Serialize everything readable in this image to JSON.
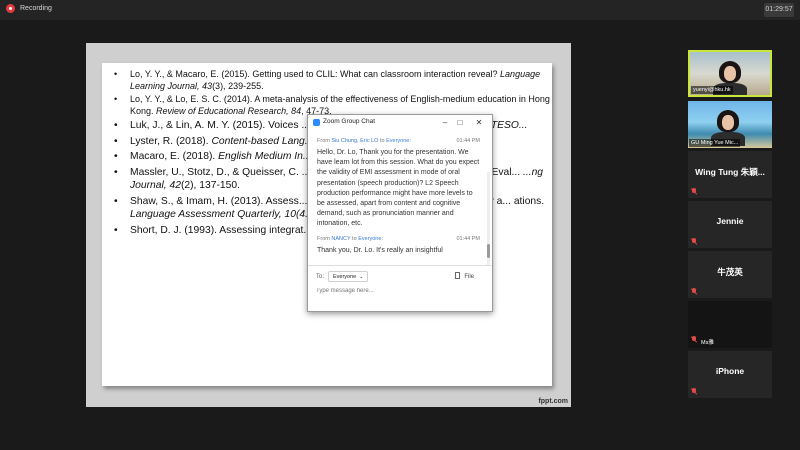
{
  "topbar": {
    "recording_label": "Recording",
    "clock": "01:29:57"
  },
  "slide": {
    "references_html": [
      "Lo, Y. Y., &amp; Macaro, E. (2015). Getting used to CLIL: What can classroom interaction reveal? <i>Language Learning Journal, 43</i>(3), 239-255.",
      "Lo, Y. Y., &amp; Lo, E. S. C. (2014). A meta-analysis of the effectiveness of English-medium education in Hong Kong. <i>Review of Educational Research, 84</i>, 47-73.",
      "Luk, J., &amp; Lin, A. M. Y. (2015). Voices ... talk in English as a Second Language. <i>TESO...</i>",
      "Lyster, R. (2018). <i>Content-based Lang...</i>",
      "Macaro, E. (2018). <i>English Medium In...</i> ...ess.",
      "Massler, U., Stotz, D., &amp; Queisser, C. ... mary CLIL: The Conceptualisation and Eval... <i>...ng Journal, 42</i>(2), 137-150.",
      "Shaw, S., &amp; Imam, H. (2013). Assess... the Medium of English: Ensuring Validity a... ations. <i>Language Assessment Quarterly, 10(4...</i>",
      "Short, D. J. (1993). Assessing integrat... <i>TESOL Quarterly, 27</i>(4), 627–656."
    ],
    "watermark": "fppt.com"
  },
  "chat": {
    "title": "Zoom Group Chat",
    "messages": [
      {
        "from_prefix": "From ",
        "sender": "Siu Chung, Eric LO",
        "to_prefix": " to ",
        "recipient": "Everyone",
        "suffix": ":",
        "time": "01:44 PM",
        "text": "Hello, Dr. Lo, Thank you for the presentation. We have learn lot from this session. What do you expect the validity of EMI assessment in mode of oral presentation (speech production)? L2 Speech production performance might have more levels to be assessed, apart from content and cognitive demand, such as pronunciation manner and intonation, etc."
      },
      {
        "from_prefix": "From ",
        "sender": "NANCY",
        "to_prefix": " to ",
        "recipient": "Everyone",
        "suffix": ":",
        "time": "01:44 PM",
        "text": "Thank you, Dr. Lo. It's really an insightful"
      }
    ],
    "to_label": "To:",
    "to_value": "Everyone",
    "file_label": "File",
    "input_placeholder": "Type message here..."
  },
  "participants": [
    {
      "name": "yuenyi@hku.hk",
      "video": true,
      "active": true
    },
    {
      "name": "GU Ming Yue Mic...",
      "video": true,
      "active": false
    },
    {
      "name": "Wing Tung 朱穎...",
      "video": false,
      "active": false
    },
    {
      "name": "Jennie",
      "video": false,
      "active": false
    },
    {
      "name": "牛茂英",
      "video": false,
      "active": false
    },
    {
      "name": "Ms雅",
      "video": false,
      "active": false
    },
    {
      "name": "iPhone",
      "video": false,
      "active": false
    }
  ],
  "colors": {
    "active_speaker_border": "#c8e63c",
    "mute_icon": "#e24a4a",
    "chat_link": "#3a7bd5",
    "recording": "#e23b3b"
  }
}
